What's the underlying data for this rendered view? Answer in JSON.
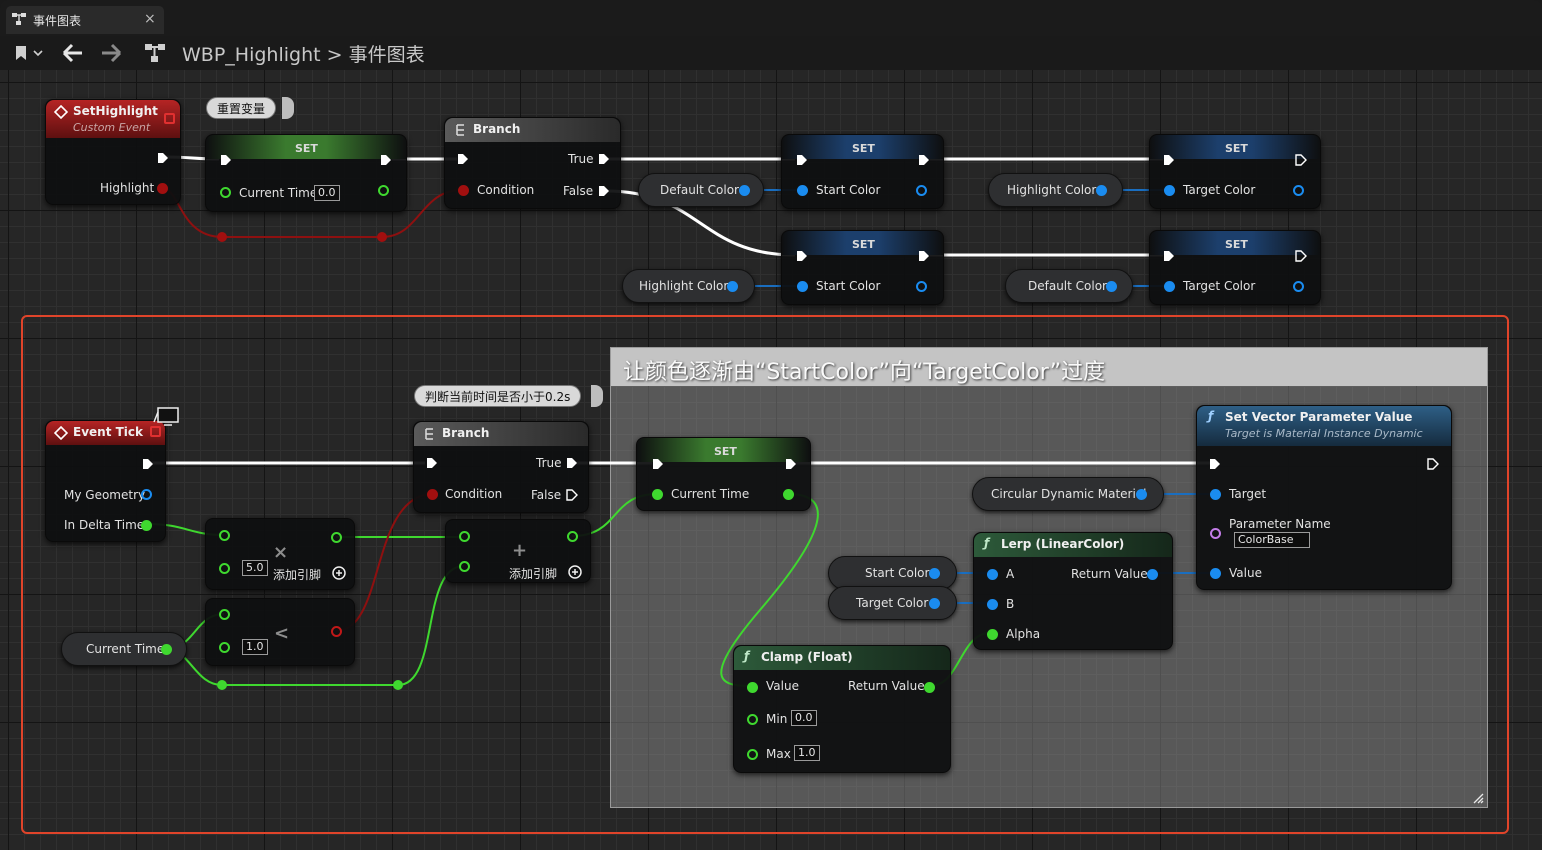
{
  "window": {
    "tab_label": "事件图表",
    "tab_close": "×",
    "breadcrumb_asset": "WBP_Highlight",
    "breadcrumb_separator": ">",
    "breadcrumb_graph": "事件图表"
  },
  "toolbar": {
    "bookmark_icon": "bookmark-icon",
    "back_icon": "arrow-left-icon",
    "forward_icon": "arrow-right-icon",
    "graph_icon": "graph-icon"
  },
  "colors": {
    "exec_wire": "#ffffff",
    "float_pin": "#3fd82f",
    "struct_pin": "#1a8cf0",
    "bool_pin": "#a10f0f",
    "event_header": "#8f1a1a",
    "set_header": "#2e6b2e",
    "branch_header": "#4a4a4a",
    "function_header": "#1e4a6a",
    "comment_outline": "#e0442a"
  },
  "top": {
    "custom_event": {
      "title": "SetHighlight",
      "subtitle": "Custom Event",
      "output": "Highlight"
    },
    "reset_bubble": "重置变量",
    "set_time": {
      "title": "SET",
      "input_label": "Current Time",
      "input_value": "0.0"
    },
    "branch": {
      "title": "Branch",
      "condition": "Condition",
      "true_label": "True",
      "false_label": "False"
    },
    "set1": {
      "title": "SET",
      "label": "Start Color"
    },
    "set2": {
      "title": "SET",
      "label": "Target Color"
    },
    "set3": {
      "title": "SET",
      "label": "Start Color"
    },
    "set4": {
      "title": "SET",
      "label": "Target Color"
    },
    "get_default_1": "Default Color",
    "get_highlight_1": "Highlight Color",
    "get_highlight_2": "Highlight Color",
    "get_default_2": "Default Color"
  },
  "bottom": {
    "event_tick": {
      "title": "Event Tick",
      "geometry": "My Geometry",
      "delta": "In Delta Time"
    },
    "judge_bubble": "判断当前时间是否小于0.2s",
    "branch": {
      "title": "Branch",
      "condition": "Condition",
      "true_label": "True",
      "false_label": "False"
    },
    "multiply": {
      "symbol": "×",
      "value": "5.0",
      "add_pin": "添加引脚"
    },
    "add": {
      "symbol": "+",
      "add_pin": "添加引脚"
    },
    "less": {
      "symbol": "<",
      "value": "1.0"
    },
    "get_current_time": "Current Time",
    "set_time": {
      "title": "SET",
      "label": "Current Time"
    },
    "comment": "让颜色逐渐由“StartColor”向“TargetColor”过度",
    "set_vector": {
      "title": "Set Vector Parameter Value",
      "subtitle": "Target is Material Instance Dynamic",
      "target": "Target",
      "param_name_label": "Parameter Name",
      "param_name_value": "ColorBase",
      "value": "Value"
    },
    "get_material": "Circular Dynamic Material",
    "lerp": {
      "title": "Lerp (LinearColor)",
      "a": "A",
      "b": "B",
      "alpha": "Alpha",
      "return": "Return Value"
    },
    "get_start_color": "Start Color",
    "get_target_color": "Target Color",
    "clamp": {
      "title": "Clamp (Float)",
      "value": "Value",
      "return": "Return Value",
      "min_label": "Min",
      "min_value": "0.0",
      "max_label": "Max",
      "max_value": "1.0"
    }
  }
}
